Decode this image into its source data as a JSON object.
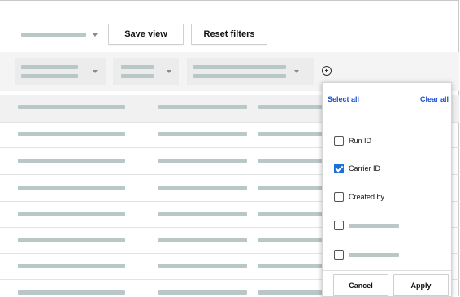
{
  "toolbar": {
    "save_view_label": "Save view",
    "reset_filters_label": "Reset filters"
  },
  "column_chooser": {
    "select_all_label": "Select all",
    "clear_all_label": "Clear all",
    "options": [
      {
        "label": "Run ID",
        "checked": false
      },
      {
        "label": "Carrier ID",
        "checked": true
      },
      {
        "label": "Created by",
        "checked": false
      },
      {
        "label": "",
        "checked": false
      },
      {
        "label": "",
        "checked": false
      }
    ],
    "cancel_label": "Cancel",
    "apply_label": "Apply"
  },
  "icons": {
    "add_filter": "plus-circle-icon",
    "dropdown": "chevron-down-icon",
    "checkmark": "checkmark-icon"
  },
  "colors": {
    "accent": "#1a6fd9",
    "link": "#1a4fd6",
    "placeholder": "#b9c7c7"
  }
}
